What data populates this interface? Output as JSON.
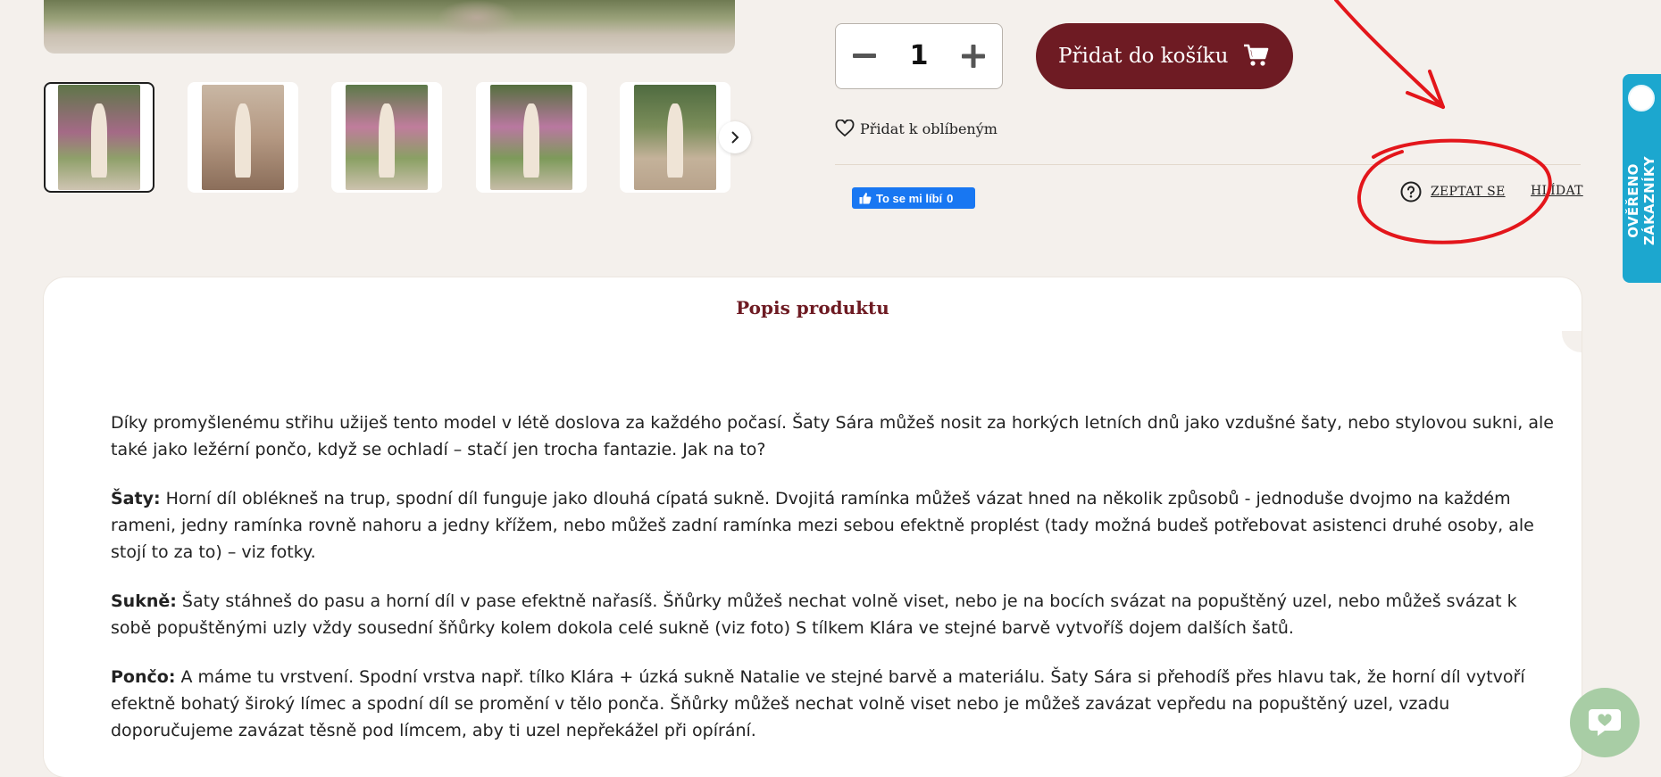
{
  "product": {
    "quantity": "1",
    "add_to_cart_label": "Přidat do košíku",
    "add_to_favorites_label": "Přidat k oblíbeným",
    "ask_label": "ZEPTAT SE",
    "watch_label": "HLÍDAT"
  },
  "social": {
    "like_label": "To se mi líbí",
    "like_count": "0"
  },
  "badge": {
    "label": "OVĚŘENO ZÁKAZNÍKY"
  },
  "description": {
    "title": "Popis produktu",
    "intro": "Díky promyšlenému střihu užiješ tento model v létě doslova za každého počasí.  Šaty Sára můžeš nosit  za horkých letních dnů jako vzdušné šaty, nebo stylovou sukni, ale také jako ležérní pončo, když se ochladí – stačí jen trocha fantazie. Jak na to?",
    "sections": [
      {
        "heading": "Šaty:",
        "text": " Horní díl oblékneš na trup, spodní díl funguje jako dlouhá cípatá sukně. Dvojitá ramínka můžeš vázat hned na několik způsobů - jednoduše dvojmo na každém rameni, jedny ramínka rovně nahoru a jedny křížem, nebo můžeš zadní ramínka mezi sebou efektně proplést (tady možná budeš potřebovat asistenci druhé osoby, ale stojí to za to) – viz fotky."
      },
      {
        "heading": "Sukně:",
        "text": " Šaty stáhneš do pasu a horní díl v pase efektně nařasíš. Šňůrky můžeš nechat volně viset, nebo je na bocích svázat na popuštěný uzel, nebo můžeš svázat k sobě popuštěnými uzly vždy sousední šňůrky kolem dokola celé sukně (viz foto) S tílkem Klára ve stejné barvě vytvoříš dojem dalších šatů."
      },
      {
        "heading": "Pončo:",
        "text": " A máme tu vrstvení. Spodní vrstva např. tílko Klára + úzká sukně Natalie ve stejné barvě a materiálu. Šaty Sára si přehodíš přes hlavu tak, že horní díl vytvoří efektně bohatý široký límec a spodní díl se promění v tělo ponča. Šňůrky můžeš nechat volně viset nebo je můžeš zavázat vepředu na popuštěný uzel, vzadu doporučujeme zavázat těsně pod límcem, aby ti uzel nepřekážel při opírání."
      }
    ]
  },
  "colors": {
    "accent": "#6e1b23",
    "background": "#f4f0ec",
    "annotation": "#e3161b",
    "badge": "#1ca7cf",
    "chat": "#a8cda5"
  }
}
